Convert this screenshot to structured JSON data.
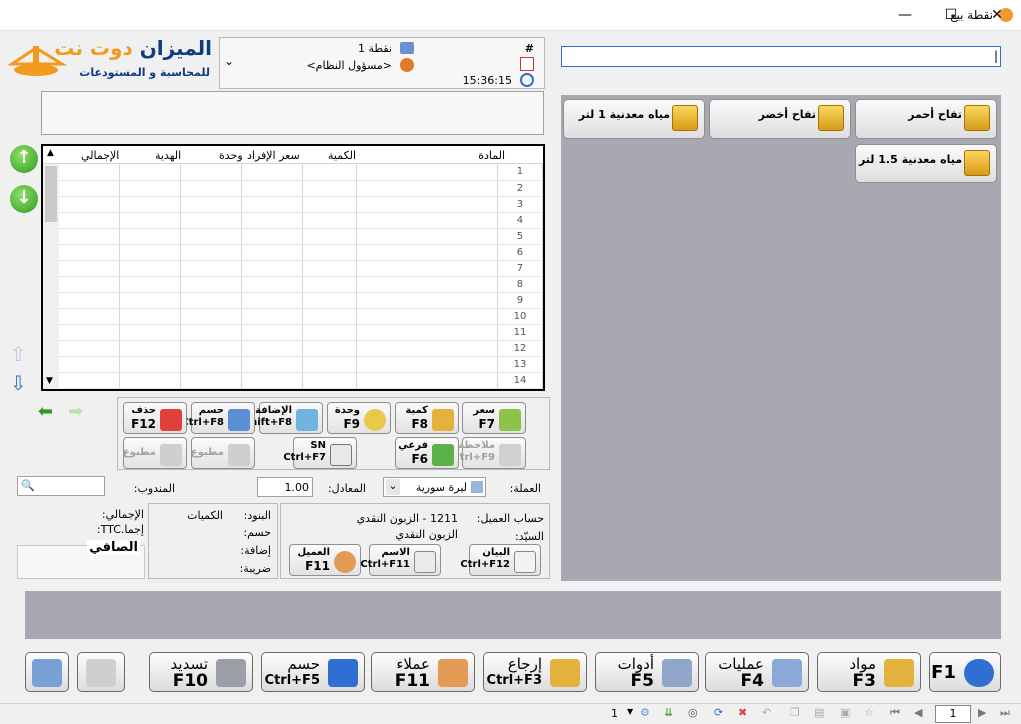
{
  "window": {
    "title": "نقطة بيع"
  },
  "logo": {
    "brand": "الميزان",
    "brand2": "دوت نت",
    "tagline": "للمحاسبة و المستودعات"
  },
  "header": {
    "hash": "#",
    "point": "نقطة 1",
    "user": "<مسؤول النظام>",
    "time": "15:36:15",
    "search_value": "|"
  },
  "grid": {
    "columns": [
      "المادة",
      "الكمية",
      "سعر الإفراد",
      "وحدة",
      "الهدية",
      "الإجمالي"
    ],
    "rows": [
      "1",
      "2",
      "3",
      "4",
      "5",
      "6",
      "7",
      "8",
      "9",
      "10",
      "11",
      "12",
      "13",
      "14"
    ]
  },
  "edit_buttons": {
    "price": {
      "l1": "سعر",
      "l2": "F7"
    },
    "qty": {
      "l1": "كمية",
      "l2": "F8"
    },
    "unit": {
      "l1": "وحدة",
      "l2": "F9"
    },
    "add": {
      "l1": "الإضافة",
      "l2": "Shift+F8"
    },
    "discount": {
      "l1": "حسم",
      "l2": "Ctrl+F8"
    },
    "delete": {
      "l1": "حذف",
      "l2": "F12"
    },
    "note": {
      "l1": "ملاحظة",
      "l2": "Ctrl+F9"
    },
    "sub": {
      "l1": "فرعي",
      "l2": "F6"
    },
    "sn": {
      "l1": "SN",
      "l2": "Ctrl+F7"
    },
    "printed1": {
      "l1": "مطبوع"
    },
    "printed2": {
      "l1": "مطبوع"
    }
  },
  "currency": {
    "label": "العملة:",
    "value": "ليرة سورية",
    "rate_label": "المعادل:",
    "rate_value": "1.00",
    "rep_label": "المندوب:"
  },
  "customer": {
    "account_label": "حساب العميل:",
    "account_value": "1211 - الزبون النقدي",
    "mr_label": "السيّد:",
    "mr_value": "الزبون النقدي",
    "statement": {
      "l1": "البيان",
      "l2": "Ctrl+F12"
    },
    "name": {
      "l1": "الاسم",
      "l2": "Ctrl+F11"
    },
    "client": {
      "l1": "العميل",
      "l2": "F11"
    }
  },
  "totals": {
    "items": "البنود:",
    "quantities": "الكميات",
    "discount": "حسم:",
    "addition": "إضافة:",
    "tax": "ضريبة:",
    "total": "الإجمالي:",
    "total_ttc": "إجما.TTC:",
    "net": "الصافي"
  },
  "products": [
    {
      "name": "تفاح أحمر"
    },
    {
      "name": "تفاح أخضر"
    },
    {
      "name": "مياه معدنية 1 لتر"
    },
    {
      "name": "مياه معدنية 1.5 لتر"
    }
  ],
  "fkeys": [
    {
      "l1": "",
      "l2": "F1",
      "color": "#2f6fd1"
    },
    {
      "l1": "مواد",
      "l2": "F3",
      "color": "#e3b23c"
    },
    {
      "l1": "عمليات",
      "l2": "F4",
      "color": "#8aa9d8"
    },
    {
      "l1": "أدوات",
      "l2": "F5",
      "color": "#8fa6c7"
    },
    {
      "l1": "إرجاع",
      "l2": "Ctrl+F3",
      "color": "#e3b23c"
    },
    {
      "l1": "عملاء",
      "l2": "F11",
      "color": "#e39a54"
    },
    {
      "l1": "حسم",
      "l2": "Ctrl+F5",
      "color": "#2f6fd1"
    },
    {
      "l1": "تسديد",
      "l2": "F10",
      "color": "#9aa0a6"
    },
    {
      "l1": "",
      "l2": "",
      "color": "#cfcfcf"
    },
    {
      "l1": "",
      "l2": "",
      "color": "#7aa1d6"
    }
  ],
  "status": {
    "page": "1",
    "left_value": "1"
  }
}
